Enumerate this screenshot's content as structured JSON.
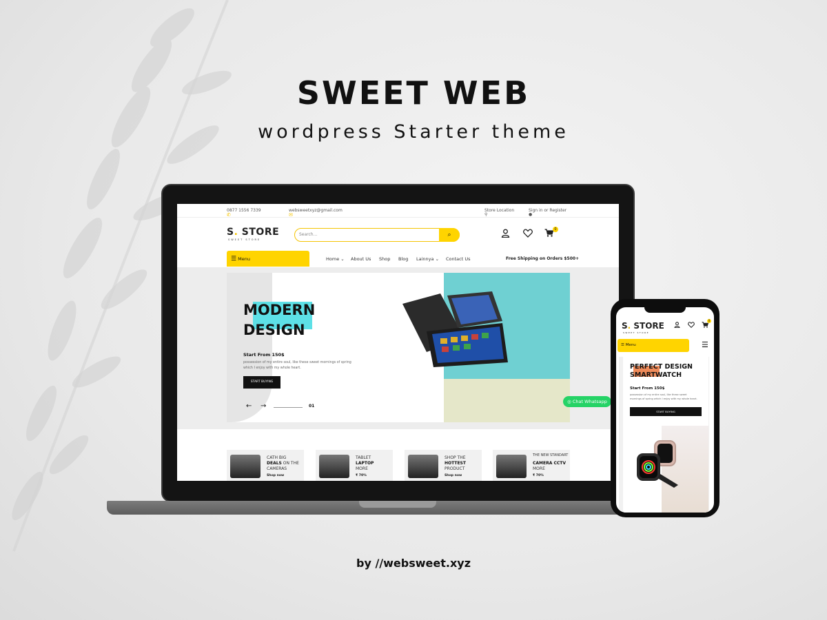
{
  "promo": {
    "title": "SWEET WEB",
    "subtitle": "wordpress Starter theme",
    "byline": "by //websweet.xyz"
  },
  "desktop": {
    "topbar": {
      "phone": "0877 1556 7339",
      "email": "websweetxyz@gmail.com",
      "store_location": "Store Location",
      "signin": "Sign in or Register"
    },
    "logo": "S. STORE",
    "logo_dot": ".",
    "logo_text": "STORE",
    "logo_s": "S",
    "logo_tag": "SWEET STORE",
    "search": {
      "placeholder": "Search...",
      "button_icon": "search-icon"
    },
    "header_icons": [
      "user-icon",
      "heart-icon",
      "cart-icon"
    ],
    "cart_count": "0",
    "menu_label": "Menu",
    "nav": [
      "Home",
      "About Us",
      "Shop",
      "Blog",
      "Lainnya",
      "Contact Us"
    ],
    "shipping": "Free Shipping on Orders $500+",
    "slide": {
      "heading_line1": "MODERN",
      "heading_line2": "DESIGN",
      "start_from": "Start From 150$",
      "description": "possession of my entire soul, like these sweet mornings of spring which I enjoy with my whole heart.",
      "cta": "START BUYING",
      "index": "01",
      "prev_arrow": "←",
      "next_arrow": "→"
    },
    "whatsapp": "Chat Whatsapp",
    "categories": [
      {
        "line1": "CATH BIG",
        "bold": "DEALS",
        "line2_suffix": " ON THE",
        "line3": "CAMERAS",
        "shop": "Shop now"
      },
      {
        "line1": "TABLET",
        "bold": "LAPTOP",
        "line2_suffix": "",
        "line3": "MORE",
        "shop": "₹ 70%"
      },
      {
        "line1": "SHOP THE",
        "bold": "HOTTEST",
        "line2_suffix": "",
        "line3": "PRODUCT",
        "shop": "Shop now"
      },
      {
        "line1": "THE NEW STANDART",
        "bold": "CAMERA CCTV",
        "line2_suffix": "",
        "line3": "MORE",
        "shop": "₹ 70%"
      }
    ]
  },
  "mobile": {
    "logo_s": "S",
    "logo_dot": ".",
    "logo_text": "STORE",
    "logo_tag": "SWEET STORE",
    "menu_label": "Menu",
    "cart_count": "0",
    "slide": {
      "heading_line1": "PERFECT DESIGN",
      "heading_line2": "SMARTWATCH",
      "start_from": "Start From 150$",
      "description": "possession of my entire soul, like these sweet mornings of spring which I enjoy with my whole heart.",
      "cta": "START BUYING"
    }
  },
  "colors": {
    "accent_yellow": "#ffd400",
    "teal": "#6fd0d2",
    "whatsapp_green": "#25d366",
    "dark": "#111111"
  }
}
